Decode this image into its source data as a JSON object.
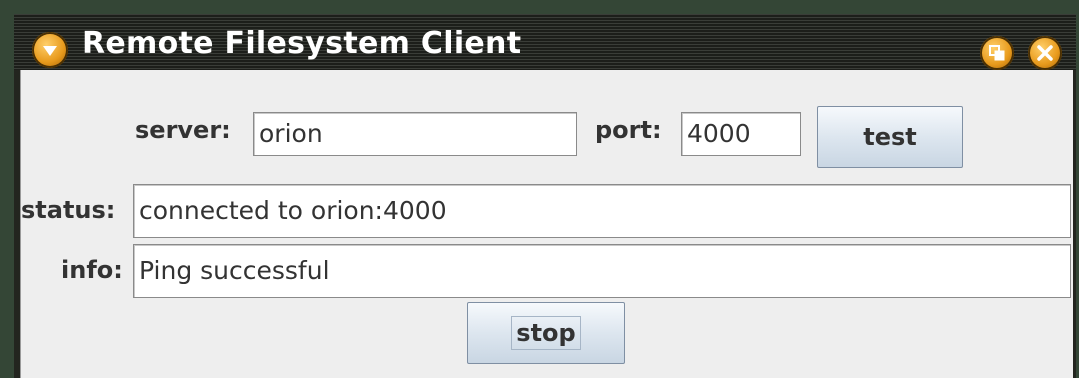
{
  "window": {
    "title": "Remote Filesystem Client"
  },
  "connection": {
    "server_label": "server:",
    "server_value": "orion",
    "port_label": "port:",
    "port_value": "4000",
    "test_button": "test"
  },
  "status": {
    "label": "status:",
    "value": "connected to orion:4000"
  },
  "info": {
    "label": "info:",
    "value": "Ping successful"
  },
  "actions": {
    "stop_button": "stop"
  },
  "colors": {
    "title_icon": "#e89a1c",
    "titlebar": "#1c1e1a",
    "content_bg": "#eeeeee"
  }
}
